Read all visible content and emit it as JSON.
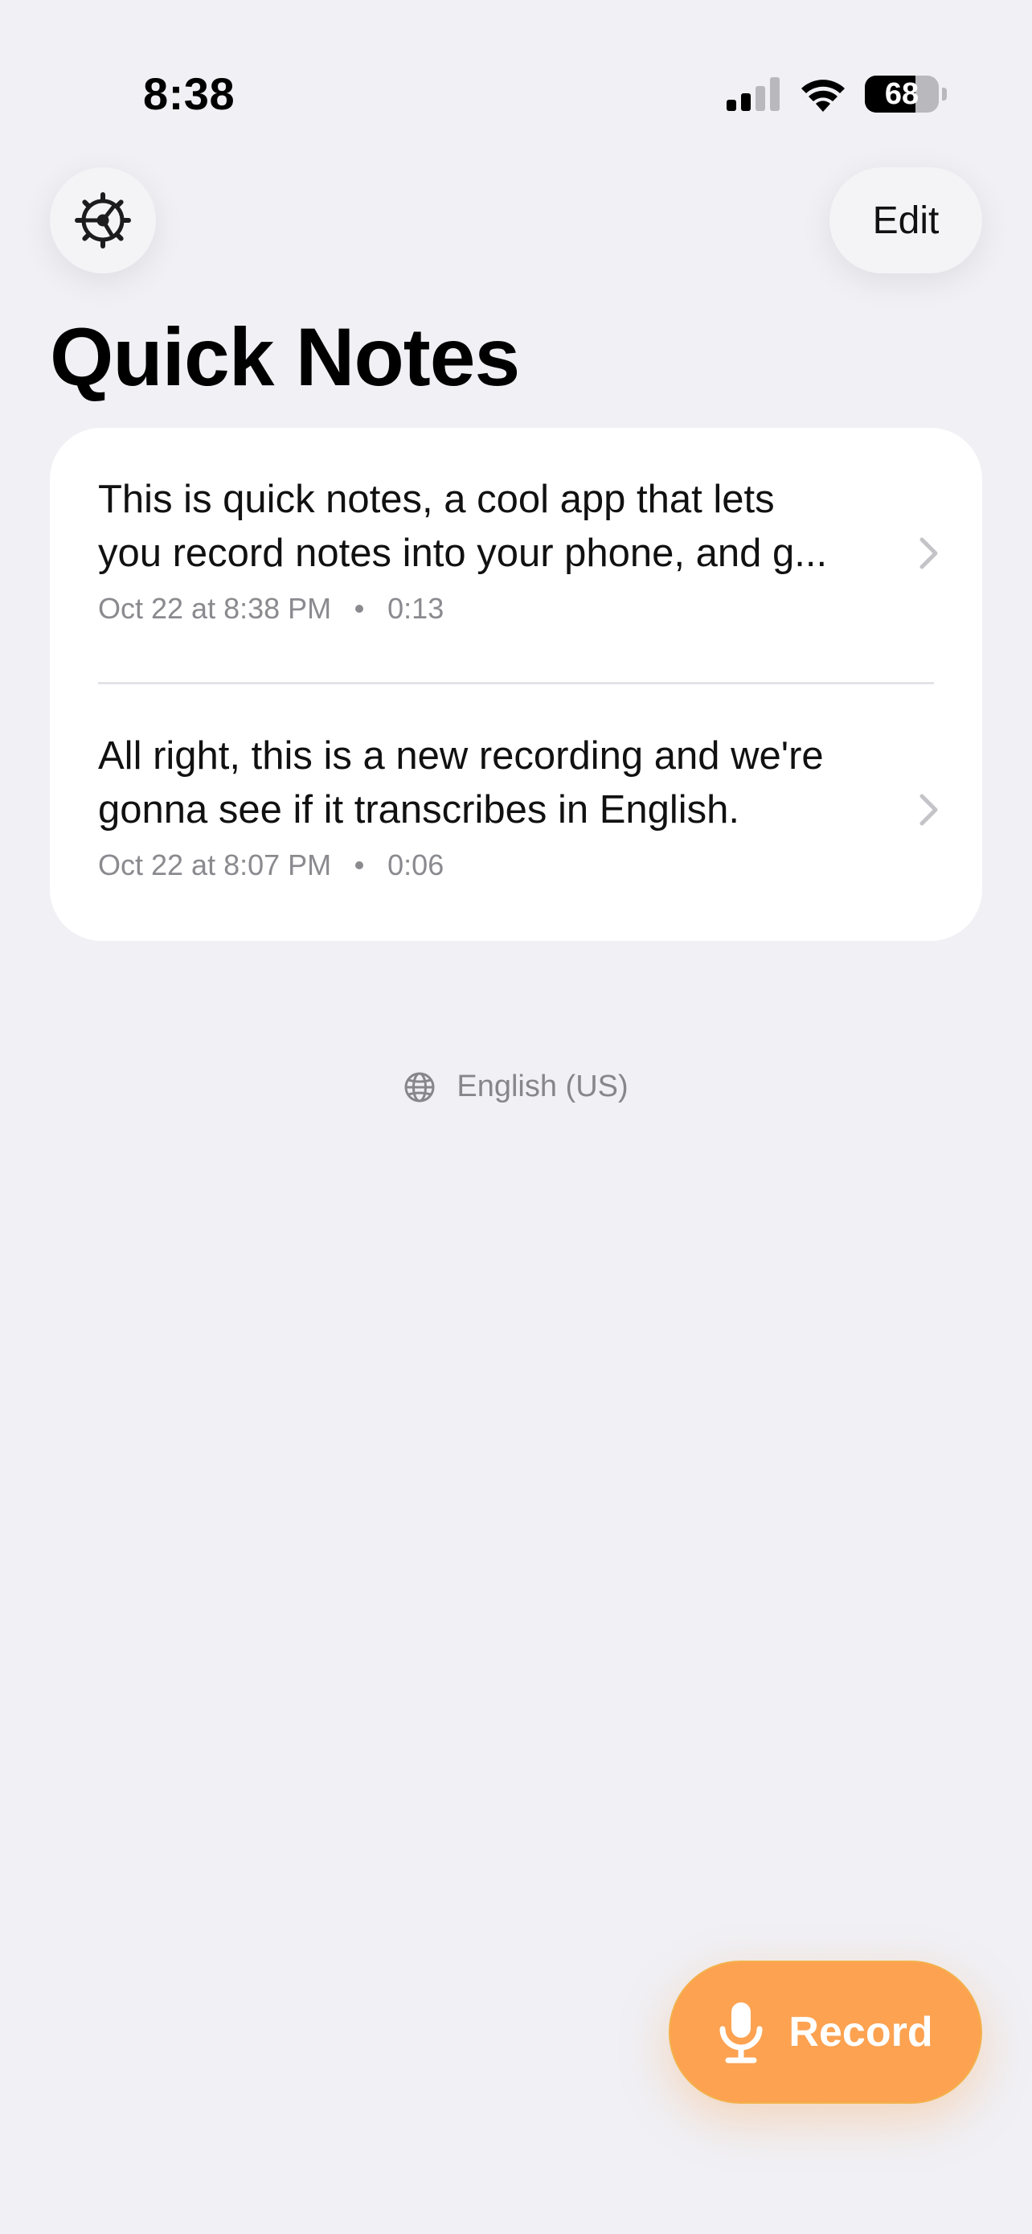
{
  "status_bar": {
    "time": "8:38",
    "battery": "68",
    "battery_level": 0.68,
    "signal_bars": 2,
    "icons": [
      "cellular-signal-icon",
      "wifi-icon",
      "battery-icon"
    ]
  },
  "header": {
    "settings_icon": "gear-icon",
    "edit_label": "Edit",
    "title": "Quick Notes"
  },
  "notes": [
    {
      "line1": "This is quick notes, a cool app that lets",
      "line2": "you record notes into your phone, and g...",
      "date": "Oct 22 at 8:38 PM",
      "duration": "0:13"
    },
    {
      "line1": "All right, this is a new recording and we're",
      "line2": "gonna see if it transcribes in English.",
      "date": "Oct 22 at 8:07 PM",
      "duration": "0:06"
    }
  ],
  "language": {
    "icon": "globe-icon",
    "label": "English (US)"
  },
  "record_button": {
    "icon": "microphone-icon",
    "label": "Record"
  },
  "colors": {
    "background": "#f0f0f5",
    "card": "#ffffff",
    "accent": "#fca251",
    "secondary_text": "#8a8a8f"
  }
}
